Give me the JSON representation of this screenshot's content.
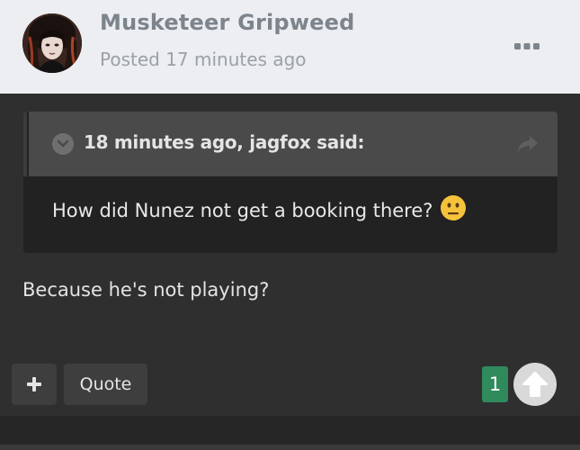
{
  "post": {
    "author_name": "Musketeer Gripweed",
    "posted_time": "Posted 17 minutes ago",
    "menu_icon": "more-horizontal-icon",
    "avatar_icon": "user-avatar"
  },
  "quote": {
    "citation": "18 minutes ago, jagfox said:",
    "text": "How did Nunez not get a booking there?",
    "emoji": "neutral-face-emoji",
    "toggle_icon": "chevron-down-icon",
    "share_icon": "share-arrow-icon"
  },
  "body": {
    "text": "Because he's not playing?"
  },
  "actions": {
    "plus_label": "+",
    "quote_label": "Quote",
    "reaction_count": "1",
    "upvote_icon": "arrow-up-icon"
  },
  "colors": {
    "header_bg": "#eceef1",
    "author": "#7c848c",
    "reaction_green": "#2f8a5c",
    "page_bg": "#2f2f2f"
  }
}
